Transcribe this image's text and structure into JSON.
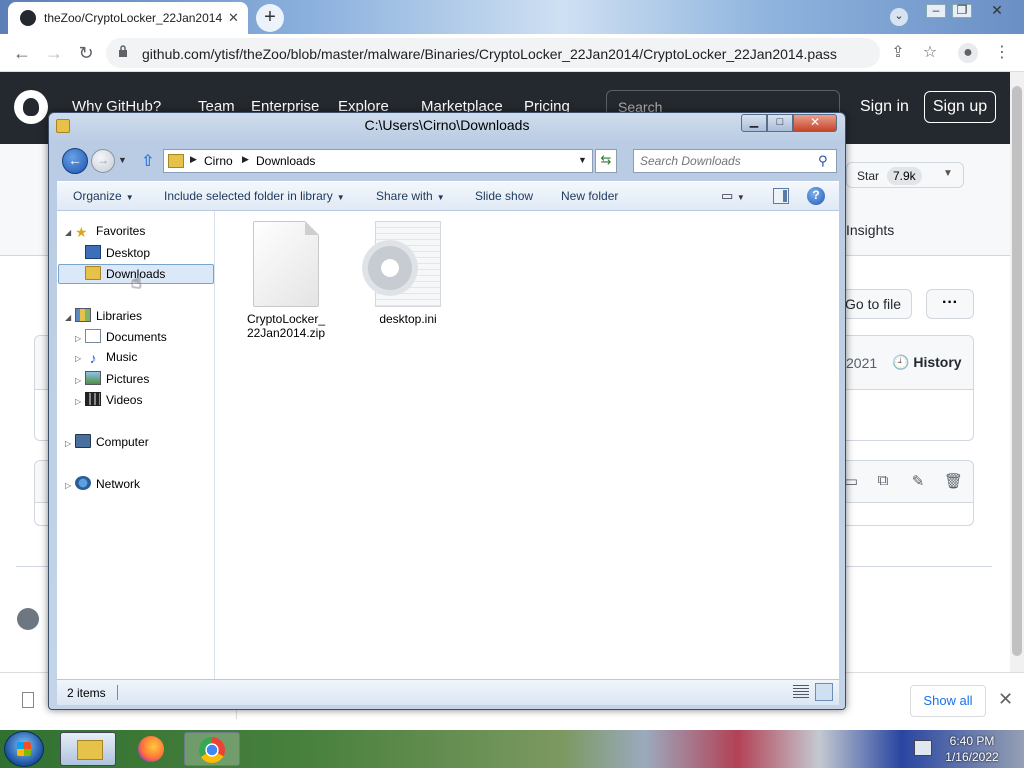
{
  "browser": {
    "tab_title": "theZoo/CryptoLocker_22Jan2014",
    "tab_close": "✕",
    "new_tab": "+",
    "url": "github.com/ytisf/theZoo/blob/master/malware/Binaries/CryptoLocker_22Jan2014/CryptoLocker_22Jan2014.pass"
  },
  "github": {
    "nav": [
      "Why GitHub?",
      "Team",
      "Enterprise",
      "Explore",
      "Marketplace",
      "Pricing"
    ],
    "search_placeholder": "Search",
    "signin": "Sign in",
    "signup": "Sign up",
    "star_label": "Star",
    "star_count": "7.9k",
    "insights": "Insights",
    "go_to_file": "Go to file",
    "more": "···",
    "commit_date": "2021",
    "history": "History"
  },
  "download_shelf": {
    "show_all": "Show all"
  },
  "explorer": {
    "title": "C:\\Users\\Cirno\\Downloads",
    "address": [
      "Cirno",
      "Downloads"
    ],
    "search_placeholder": "Search Downloads",
    "commands": {
      "organize": "Organize",
      "include": "Include selected folder in library",
      "share": "Share with",
      "slideshow": "Slide show",
      "newfolder": "New folder"
    },
    "tree": {
      "favorites": "Favorites",
      "desktop": "Desktop",
      "downloads": "Downloads",
      "libraries": "Libraries",
      "documents": "Documents",
      "music": "Music",
      "pictures": "Pictures",
      "videos": "Videos",
      "computer": "Computer",
      "network": "Network"
    },
    "files": [
      {
        "name": "CryptoLocker_22Jan2014.zip",
        "icon": "zip-file-icon"
      },
      {
        "name": "desktop.ini",
        "icon": "config-file-icon"
      }
    ],
    "status": "2 items"
  },
  "taskbar": {
    "time": "6:40 PM",
    "date": "1/16/2022"
  }
}
